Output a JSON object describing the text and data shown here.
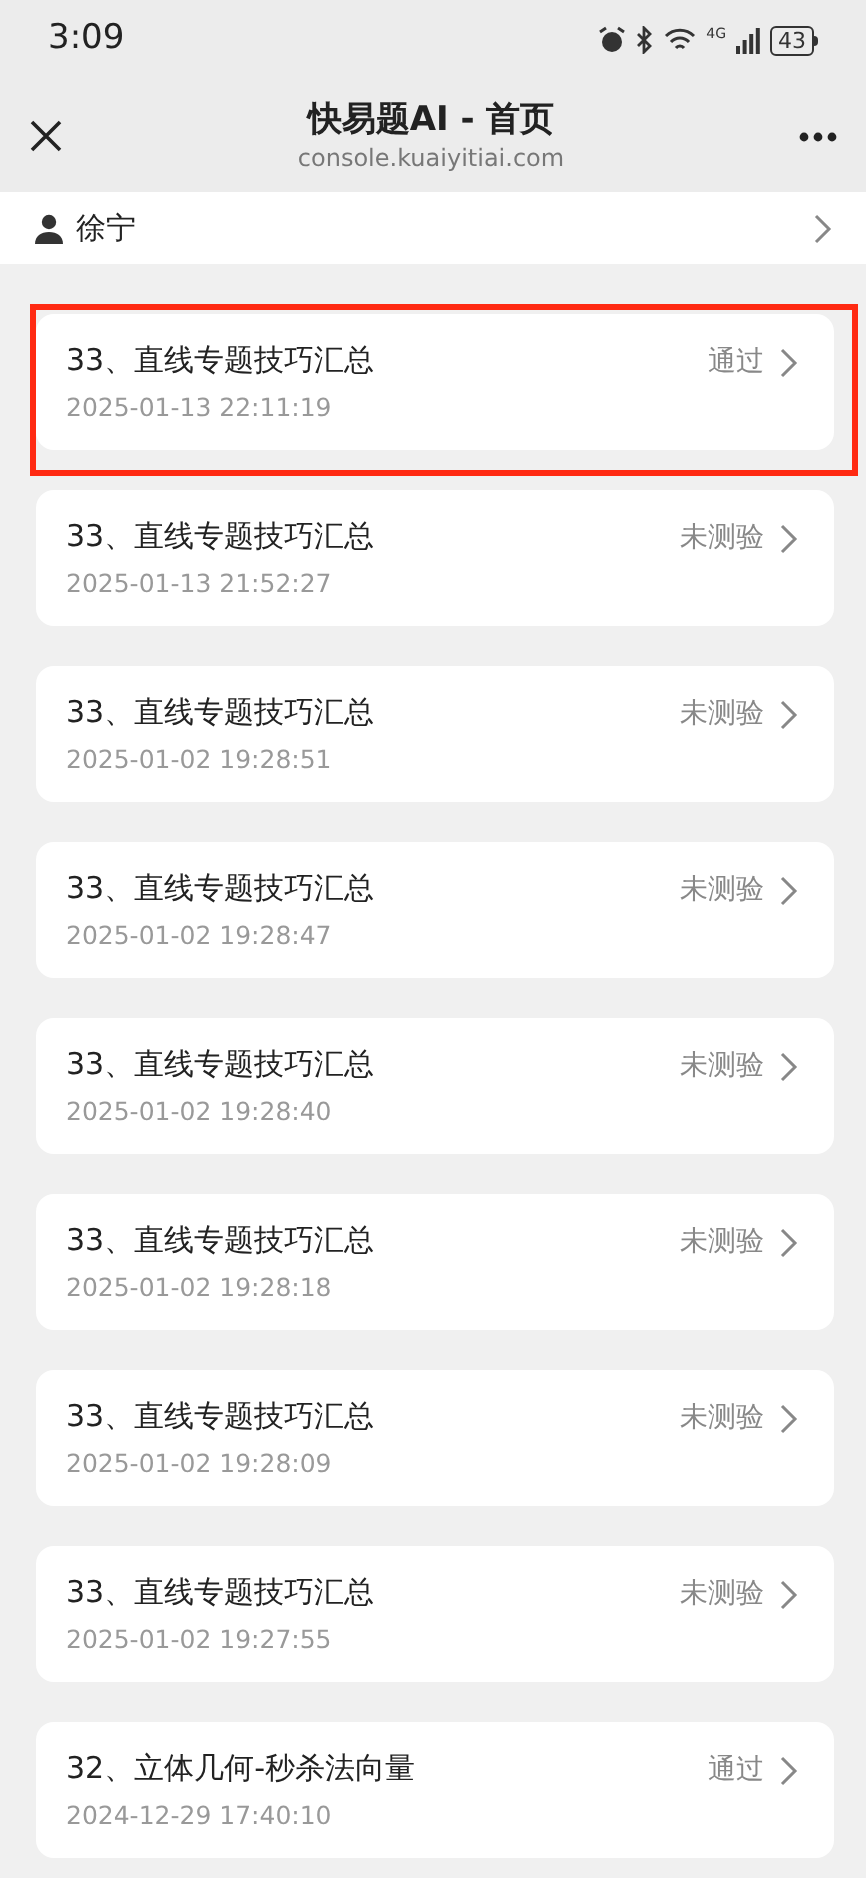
{
  "status_bar": {
    "time": "3:09",
    "network": "4G",
    "battery": "43"
  },
  "header": {
    "title": "快易题AI - 首页",
    "url": "console.kuaiyitiai.com"
  },
  "user": {
    "name": "徐宁"
  },
  "items": [
    {
      "title": "33、直线专题技巧汇总",
      "date": "2025-01-13 22:11:19",
      "status": "通过",
      "highlighted": true
    },
    {
      "title": "33、直线专题技巧汇总",
      "date": "2025-01-13 21:52:27",
      "status": "未测验",
      "highlighted": false
    },
    {
      "title": "33、直线专题技巧汇总",
      "date": "2025-01-02 19:28:51",
      "status": "未测验",
      "highlighted": false
    },
    {
      "title": "33、直线专题技巧汇总",
      "date": "2025-01-02 19:28:47",
      "status": "未测验",
      "highlighted": false
    },
    {
      "title": "33、直线专题技巧汇总",
      "date": "2025-01-02 19:28:40",
      "status": "未测验",
      "highlighted": false
    },
    {
      "title": "33、直线专题技巧汇总",
      "date": "2025-01-02 19:28:18",
      "status": "未测验",
      "highlighted": false
    },
    {
      "title": "33、直线专题技巧汇总",
      "date": "2025-01-02 19:28:09",
      "status": "未测验",
      "highlighted": false
    },
    {
      "title": "33、直线专题技巧汇总",
      "date": "2025-01-02 19:27:55",
      "status": "未测验",
      "highlighted": false
    },
    {
      "title": "32、立体几何-秒杀法向量",
      "date": "2024-12-29 17:40:10",
      "status": "通过",
      "highlighted": false
    }
  ]
}
